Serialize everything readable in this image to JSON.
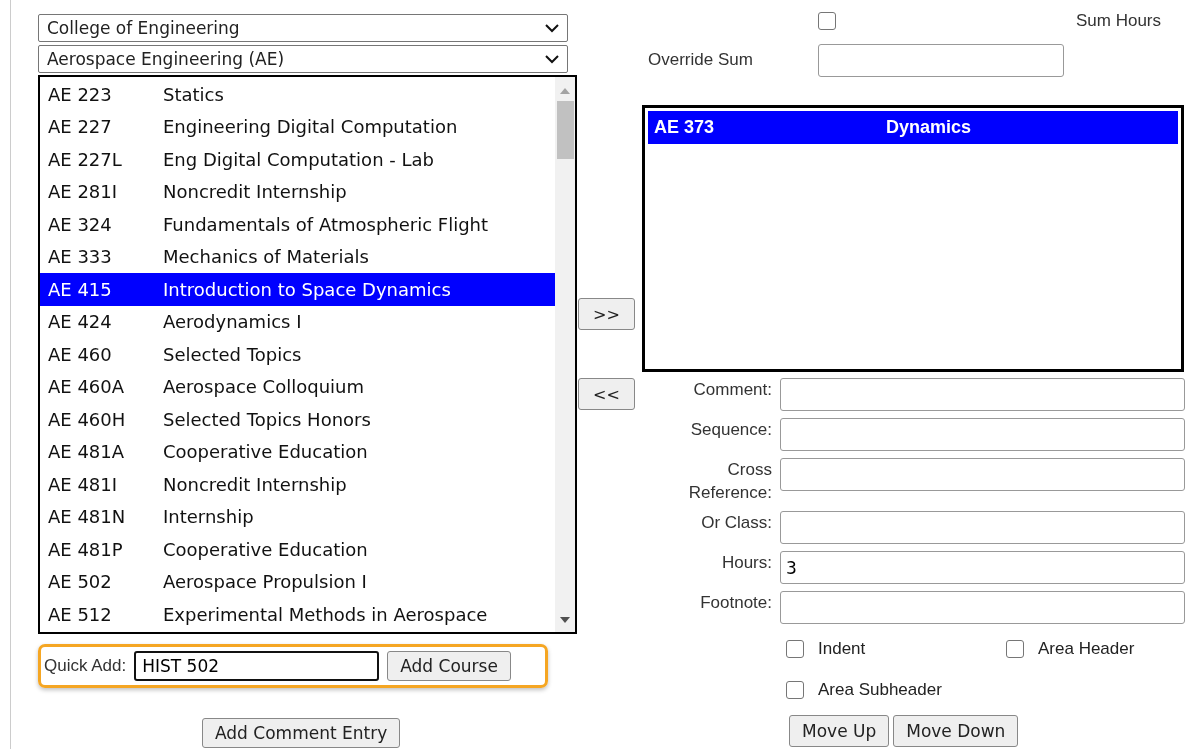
{
  "college_select": {
    "value": "College of Engineering"
  },
  "department_select": {
    "value": "Aerospace Engineering (AE)"
  },
  "course_list": [
    {
      "code": "AE 223",
      "title": "Statics",
      "selected": false
    },
    {
      "code": "AE 227",
      "title": "Engineering Digital Computation",
      "selected": false
    },
    {
      "code": "AE 227L",
      "title": "Eng Digital Computation - Lab",
      "selected": false
    },
    {
      "code": "AE 281I",
      "title": "Noncredit Internship",
      "selected": false
    },
    {
      "code": "AE 324",
      "title": "Fundamentals of Atmospheric Flight",
      "selected": false
    },
    {
      "code": "AE 333",
      "title": "Mechanics of Materials",
      "selected": false
    },
    {
      "code": "AE 415",
      "title": "Introduction to Space Dynamics",
      "selected": true
    },
    {
      "code": "AE 424",
      "title": "Aerodynamics I",
      "selected": false
    },
    {
      "code": "AE 460",
      "title": "Selected Topics",
      "selected": false
    },
    {
      "code": "AE 460A",
      "title": "Aerospace Colloquium",
      "selected": false
    },
    {
      "code": "AE 460H",
      "title": "Selected Topics Honors",
      "selected": false
    },
    {
      "code": "AE 481A",
      "title": "Cooperative Education",
      "selected": false
    },
    {
      "code": "AE 481I",
      "title": "Noncredit Internship",
      "selected": false
    },
    {
      "code": "AE 481N",
      "title": "Internship",
      "selected": false
    },
    {
      "code": "AE 481P",
      "title": "Cooperative Education",
      "selected": false
    },
    {
      "code": "AE 502",
      "title": "Aerospace Propulsion I",
      "selected": false
    },
    {
      "code": "AE 512",
      "title": "Experimental Methods in Aerospace",
      "selected": false
    }
  ],
  "quick_add": {
    "label": "Quick Add:",
    "value": "HIST 502",
    "button": "Add Course"
  },
  "add_comment_button": "Add Comment Entry",
  "move_buttons": [
    ">>",
    "<<"
  ],
  "sum_hours": {
    "label": "Sum Hours",
    "checked": false
  },
  "override_sum": {
    "label": "Override Sum"
  },
  "chosen_list": [
    {
      "code": "AE 373",
      "title": "Dynamics",
      "selected": true
    }
  ],
  "fields": [
    {
      "label": "Comment:"
    },
    {
      "label": "Sequence:"
    },
    {
      "label": "Cross Reference:"
    },
    {
      "label": "Or Class:"
    },
    {
      "label": "Hours:",
      "value": "3"
    },
    {
      "label": "Footnote:"
    }
  ],
  "options": [
    {
      "label": "Indent",
      "checked": false
    },
    {
      "label": "Area Header",
      "checked": false
    },
    {
      "label": "Area Subheader",
      "checked": false
    }
  ],
  "order_buttons": [
    "Move Up",
    "Move Down"
  ]
}
